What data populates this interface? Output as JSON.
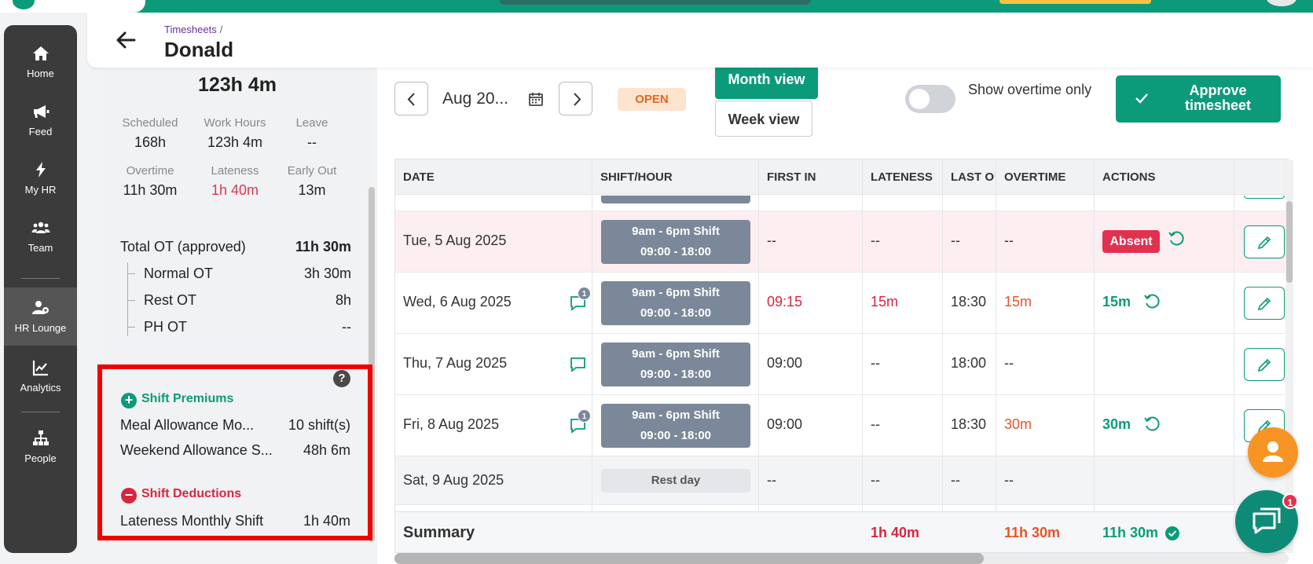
{
  "header": {
    "breadcrumb": "Timesheets",
    "breadcrumb_sep": "/",
    "title": "Donald"
  },
  "sidebar": {
    "items": [
      {
        "label": "Home",
        "icon": "home-icon"
      },
      {
        "label": "Feed",
        "icon": "megaphone-icon"
      },
      {
        "label": "My HR",
        "icon": "lightning-icon"
      },
      {
        "label": "Team",
        "icon": "team-icon"
      },
      {
        "label": "HR Lounge",
        "icon": "user-gear-icon",
        "active": true
      },
      {
        "label": "Analytics",
        "icon": "chart-icon"
      },
      {
        "label": "People",
        "icon": "org-chart-icon"
      }
    ]
  },
  "summary": {
    "total_hours": "123h 4m",
    "stats": [
      {
        "label": "Scheduled",
        "value": "168h"
      },
      {
        "label": "Work Hours",
        "value": "123h 4m"
      },
      {
        "label": "Leave",
        "value": "--"
      },
      {
        "label": "Overtime",
        "value": "11h 30m"
      },
      {
        "label": "Lateness",
        "value": "1h 40m",
        "color": "#d83a4e"
      },
      {
        "label": "Early Out",
        "value": "13m"
      }
    ],
    "total_ot_label": "Total OT (approved)",
    "total_ot_value": "11h 30m",
    "ot_breakdown": [
      {
        "label": "Normal OT",
        "value": "3h 30m"
      },
      {
        "label": "Rest OT",
        "value": "8h"
      },
      {
        "label": "PH OT",
        "value": "--"
      }
    ],
    "help_label": "?",
    "premiums_title": "Shift Premiums",
    "premiums": [
      {
        "label": "Meal Allowance Mo...",
        "value": "10 shift(s)"
      },
      {
        "label": "Weekend Allowance S...",
        "value": "48h 6m"
      }
    ],
    "deductions_title": "Shift Deductions",
    "deductions": [
      {
        "label": "Lateness Monthly Shift",
        "value": "1h 40m"
      }
    ]
  },
  "toolbar": {
    "date_label": "Aug 20...",
    "status": "OPEN",
    "month_view": "Month view",
    "week_view": "Week view",
    "overtime_toggle_label": "Show overtime only",
    "approve_label": "Approve timesheet"
  },
  "table": {
    "columns": [
      "DATE",
      "SHIFT/HOUR",
      "FIRST IN",
      "LATENESS",
      "LAST OUT",
      "OVERTIME",
      "ACTIONS"
    ],
    "rows": [
      {
        "date": "Tue, 5 Aug 2025",
        "shift_name": "9am - 6pm Shift",
        "shift_time": "09:00 - 18:00",
        "first_in": "--",
        "lateness": "--",
        "last_out": "--",
        "overtime": "--",
        "action_badge": "Absent",
        "comments": ""
      },
      {
        "date": "Wed, 6 Aug 2025",
        "shift_name": "9am - 6pm Shift",
        "shift_time": "09:00 - 18:00",
        "first_in": "09:15",
        "lateness": "15m",
        "last_out": "18:30",
        "overtime": "15m",
        "action_value": "15m",
        "comments": "1"
      },
      {
        "date": "Thu, 7 Aug 2025",
        "shift_name": "9am - 6pm Shift",
        "shift_time": "09:00 - 18:00",
        "first_in": "09:00",
        "lateness": "--",
        "last_out": "18:00",
        "overtime": "--",
        "comments": ""
      },
      {
        "date": "Fri, 8 Aug 2025",
        "shift_name": "9am - 6pm Shift",
        "shift_time": "09:00 - 18:00",
        "first_in": "09:00",
        "lateness": "--",
        "last_out": "18:30",
        "overtime": "30m",
        "action_value": "30m",
        "comments": "1"
      },
      {
        "date": "Sat, 9 Aug 2025",
        "shift_name": "Rest day",
        "first_in": "--",
        "lateness": "--",
        "last_out": "--",
        "overtime": "--"
      }
    ],
    "summary": {
      "label": "Summary",
      "lateness": "1h 40m",
      "overtime": "11h 30m",
      "approved": "11h 30m"
    }
  },
  "chat_badge": "1",
  "colors": {
    "brand_green": "#0c9b7a",
    "sidebar_bg": "#3b3b3b",
    "danger": "#d7263d",
    "overtime_orange": "#e4552a",
    "status_open_bg": "#fde4cf",
    "highlight_red": "#f00000"
  }
}
